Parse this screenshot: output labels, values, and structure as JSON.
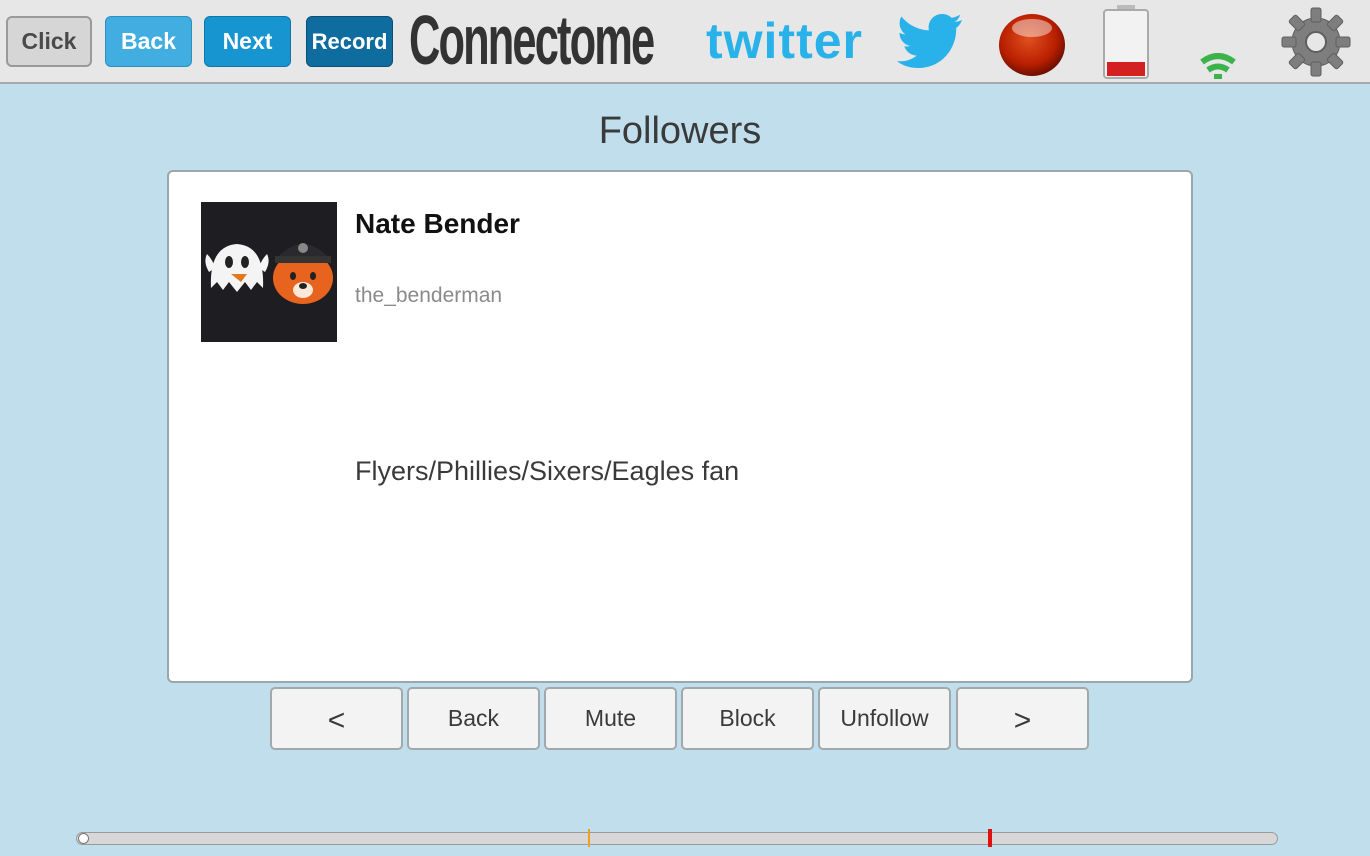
{
  "toolbar": {
    "click_label": "Click",
    "back_label": "Back",
    "next_label": "Next",
    "record_label": "Record",
    "logo_text": "Connectome",
    "twitter_logo_text": "twitter",
    "icons": [
      "twitter-bird-icon",
      "record-indicator-icon",
      "battery-icon",
      "wifi-icon",
      "gear-icon"
    ]
  },
  "page": {
    "title": "Followers"
  },
  "profile": {
    "name": "Nate Bender",
    "handle": "the_benderman",
    "bio": "Flyers/Phillies/Sixers/Eagles fan"
  },
  "actions": {
    "prev_label": "<",
    "back_label": "Back",
    "mute_label": "Mute",
    "block_label": "Block",
    "unfollow_label": "Unfollow",
    "next_label": ">"
  },
  "timeline": {
    "position": 0.0,
    "marker_1": 0.43,
    "marker_2": 0.76
  },
  "colors": {
    "background": "#c1deec",
    "battery_level": "#d32020",
    "wifi": "#3bb34a",
    "record": "#b81e00"
  }
}
